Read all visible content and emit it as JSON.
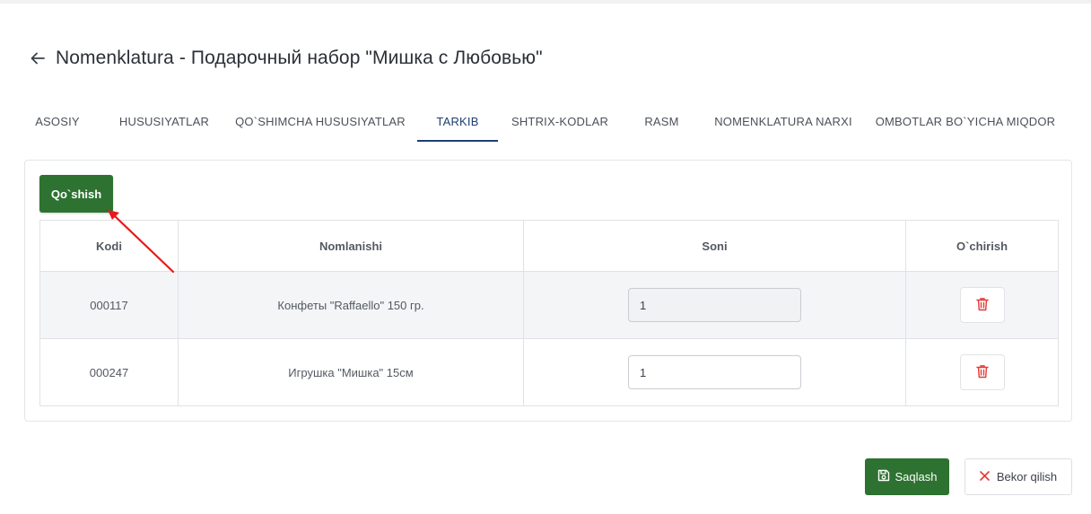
{
  "header": {
    "back_icon": "arrow-left-icon",
    "title": "Nomenklatura - Подарочный набор \"Мишка с Любовью\""
  },
  "tabs": [
    {
      "label": "ASOSIY",
      "active": false
    },
    {
      "label": "HUSUSIYATLAR",
      "active": false
    },
    {
      "label": "QO`SHIMCHA HUSUSIYATLAR",
      "active": false
    },
    {
      "label": "TARKIB",
      "active": true
    },
    {
      "label": "SHTRIX-KODLAR",
      "active": false
    },
    {
      "label": "RASM",
      "active": false
    },
    {
      "label": "NOMENKLATURA NARXI",
      "active": false
    },
    {
      "label": "OMBOTLAR BO`YICHA MIQDOR",
      "active": false
    }
  ],
  "composition": {
    "add_label": "Qo`shish",
    "columns": [
      "Kodi",
      "Nomlanishi",
      "Soni",
      "O`chirish"
    ],
    "rows": [
      {
        "code": "000117",
        "name": "Конфеты \"Raffaello\" 150 гр.",
        "qty": "1",
        "delete_icon": "trash-icon"
      },
      {
        "code": "000247",
        "name": "Игрушка \"Мишка\" 15см",
        "qty": "1",
        "delete_icon": "trash-icon"
      }
    ]
  },
  "footer": {
    "save_label": "Saqlash",
    "save_icon": "floppy-disk-icon",
    "cancel_label": "Bekor qilish",
    "cancel_icon": "close-x-icon"
  },
  "colors": {
    "primary_green": "#2e7231",
    "active_tab": "#1e3f73",
    "delete_red": "#e53935",
    "annotation_arrow": "#e8191b"
  }
}
